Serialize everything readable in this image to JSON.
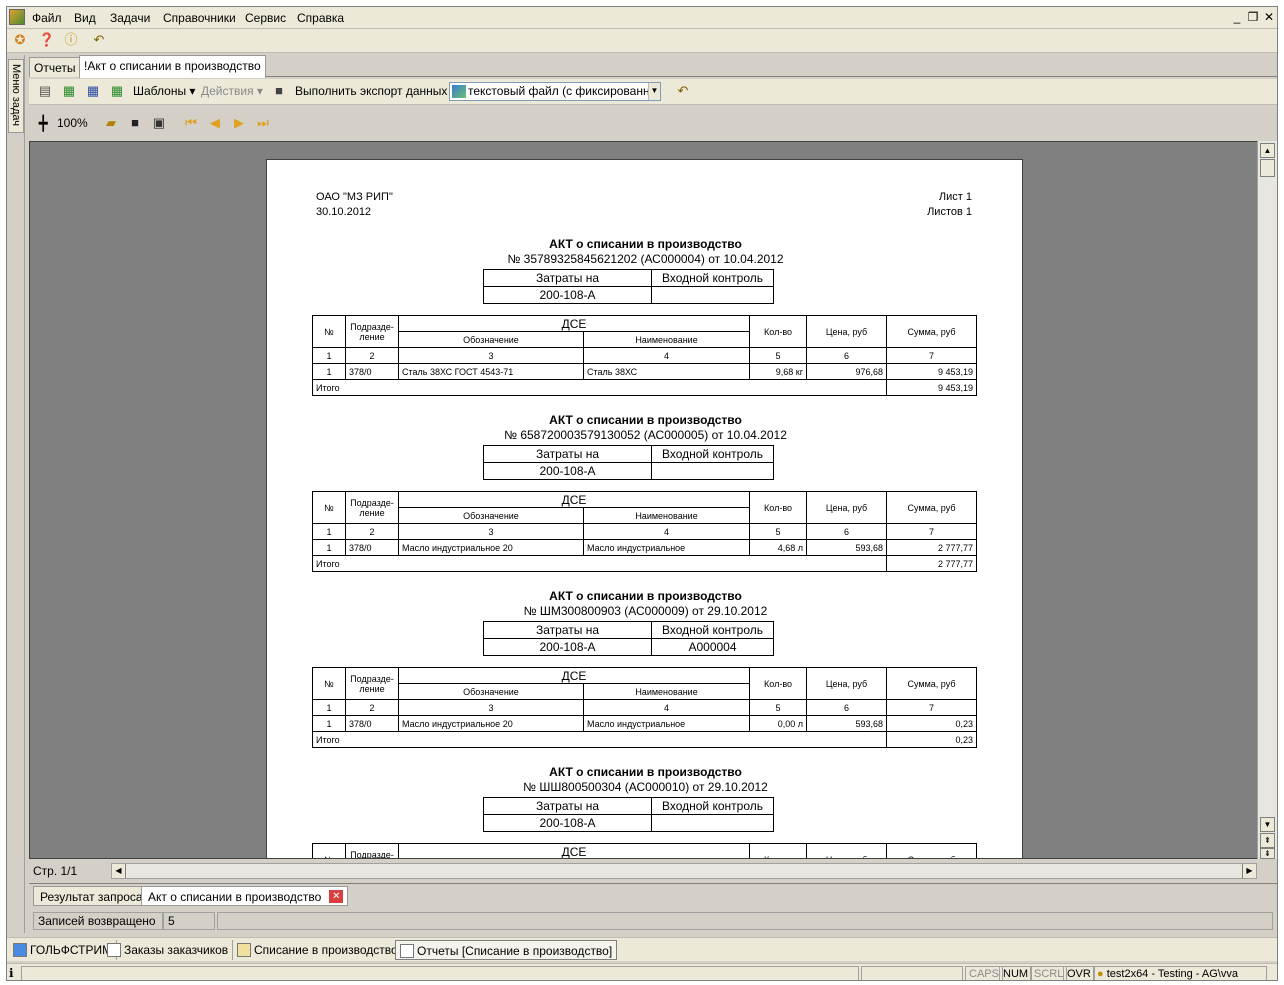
{
  "menu": [
    "Файл",
    "Вид",
    "Задачи",
    "Справочники",
    "Сервис",
    "Справка"
  ],
  "window_controls": [
    "_",
    "❐",
    "✕"
  ],
  "sidebar_label": "Меню задач",
  "tabs": [
    "Отчеты",
    "!Акт о списании в производство"
  ],
  "toolbar2": {
    "templates": "Шаблоны",
    "actions": "Действия",
    "export_label": "Выполнить экспорт данных в:",
    "export_value": "текстовый файл (с фиксированным"
  },
  "toolbar3": {
    "zoom": "100%"
  },
  "report": {
    "org": "ОАО \"МЗ РИП\"",
    "date": "30.10.2012",
    "sheet": "Лист 1",
    "sheets": "Листов 1",
    "zt_head": [
      "Затраты на",
      "Входной контроль"
    ],
    "dt_head": {
      "no": "№",
      "dept1": "Подразде-",
      "dept2": "ление",
      "dse": "ДСЕ",
      "designation": "Обозначение",
      "name": "Наименование",
      "qty": "Кол-во",
      "price": "Цена, руб",
      "sum": "Сумма, руб"
    },
    "colnums": [
      "1",
      "2",
      "3",
      "4",
      "5",
      "6",
      "7"
    ],
    "total_label": "Итого",
    "acts": [
      {
        "title": "АКТ о списании в производство",
        "sub": "№ 35789325845621202 (АС000004) от 10.04.2012",
        "zt": [
          "200-108-А",
          ""
        ],
        "row": [
          "1",
          "378/0",
          "Сталь 38ХС ГОСТ 4543-71",
          "Сталь 38ХС",
          "9,68 кг",
          "976,68",
          "9 453,19"
        ],
        "total": "9 453,19"
      },
      {
        "title": "АКТ о списании в производство",
        "sub": "№ 658720003579130052 (АС000005) от 10.04.2012",
        "zt": [
          "200-108-А",
          ""
        ],
        "row": [
          "1",
          "378/0",
          "Масло индустриальное 20",
          "Масло индустриальное",
          "4,68 л",
          "593,68",
          "2 777,77"
        ],
        "total": "2 777,77"
      },
      {
        "title": "АКТ о списании в производство",
        "sub": "№ ШМ300800903 (АС000009) от 29.10.2012",
        "zt": [
          "200-108-А",
          "А000004"
        ],
        "row": [
          "1",
          "378/0",
          "Масло индустриальное 20",
          "Масло индустриальное",
          "0,00 л",
          "593,68",
          "0,23"
        ],
        "total": "0,23"
      },
      {
        "title": "АКТ о списании в производство",
        "sub": "№ ШШ800500304 (АС000010) от 29.10.2012",
        "zt": [
          "200-108-А",
          ""
        ]
      }
    ]
  },
  "page_indicator": "Стр. 1/1",
  "bottom_tabs": [
    "Результат запроса",
    "Акт о списании в производство"
  ],
  "records": {
    "label": "Записей возвращено",
    "value": "5"
  },
  "taskbar": [
    "ГОЛЬФСТРИМ",
    "Заказы заказчиков",
    "Списание в производство",
    "Отчеты  [Списание в производство]"
  ],
  "statusbar": {
    "caps": "CAPS",
    "num": "NUM",
    "scrl": "SCRL",
    "ovr": "OVR",
    "user": "test2x64 - Testing - AG\\vva"
  }
}
